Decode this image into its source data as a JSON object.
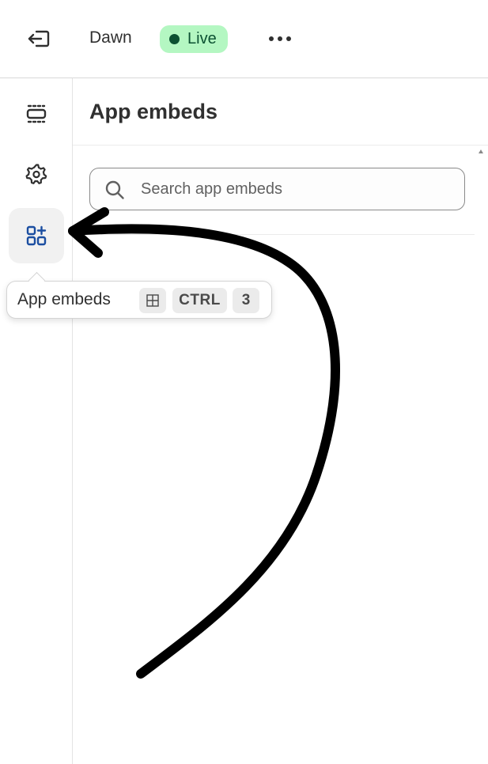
{
  "topbar": {
    "exit_icon": "exit-icon",
    "theme_name": "Dawn",
    "status_badge": "Live",
    "status_color": "#0c5132",
    "status_bg": "#b4f7c2",
    "more_icon": "more-horizontal-icon"
  },
  "rail": {
    "items": [
      {
        "name": "sections",
        "icon": "sections-icon",
        "active": false
      },
      {
        "name": "settings",
        "icon": "gear-icon",
        "active": false
      },
      {
        "name": "app-embeds",
        "icon": "app-embeds-icon",
        "active": true
      }
    ],
    "active_color": "#1b4ea1"
  },
  "panel": {
    "title": "App embeds",
    "search": {
      "placeholder": "Search app embeds",
      "value": ""
    }
  },
  "tooltip": {
    "label": "App embeds",
    "shortcut": {
      "modifier_icon": "windows-key-icon",
      "key1": "CTRL",
      "key2": "3"
    }
  },
  "annotation": {
    "type": "hand-drawn arrow pointing to app embeds button",
    "color": "#000000"
  }
}
